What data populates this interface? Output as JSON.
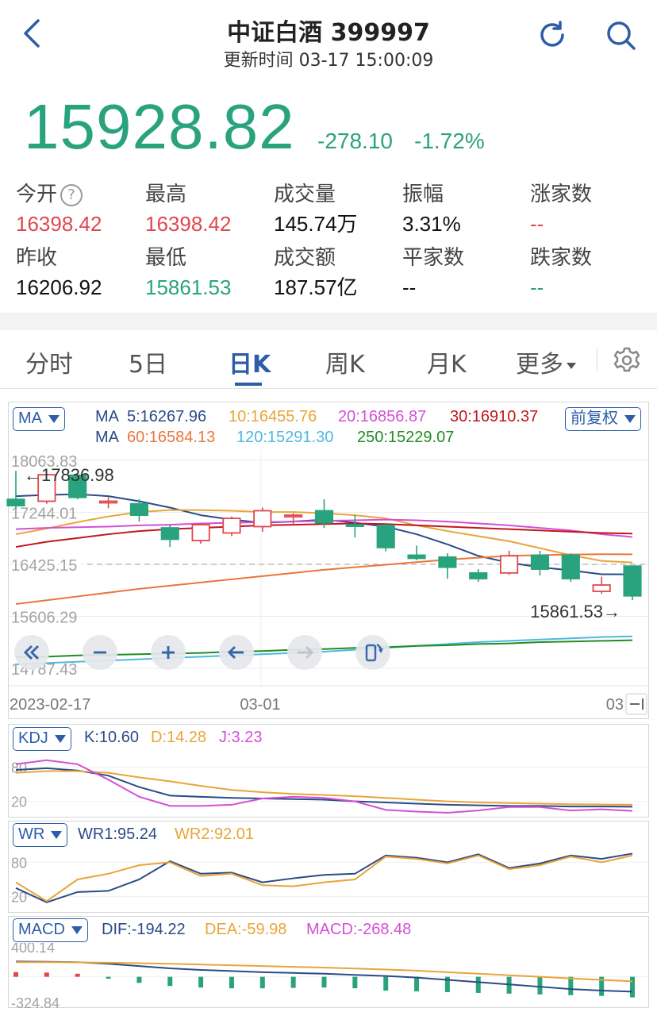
{
  "header": {
    "title": "中证白酒 399997",
    "update_label": "更新时间 03-17 15:00:09"
  },
  "quote": {
    "price": "15928.82",
    "change": "-278.10",
    "change_pct": "-1.72%"
  },
  "stats": [
    {
      "label": "今开",
      "value": "16398.42",
      "color": "red"
    },
    {
      "label": "最高",
      "value": "16398.42",
      "color": "red"
    },
    {
      "label": "成交量",
      "value": "145.74万",
      "color": "dark"
    },
    {
      "label": "振幅",
      "value": "3.31%",
      "color": "dark"
    },
    {
      "label": "涨家数",
      "value": "--",
      "color": "red"
    },
    {
      "label": "昨收",
      "value": "16206.92",
      "color": "dark"
    },
    {
      "label": "最低",
      "value": "15861.53",
      "color": "green"
    },
    {
      "label": "成交额",
      "value": "187.57亿",
      "color": "dark"
    },
    {
      "label": "平家数",
      "value": "--",
      "color": "dark"
    },
    {
      "label": "跌家数",
      "value": "--",
      "color": "green"
    }
  ],
  "tabs": [
    {
      "label": "分时"
    },
    {
      "label": "5日"
    },
    {
      "label": "日K"
    },
    {
      "label": "周K"
    },
    {
      "label": "月K"
    },
    {
      "label": "更多"
    }
  ],
  "main_panel": {
    "selector": "MA",
    "adjust": "前复权",
    "ma_label_row1": "MA",
    "ma_label_row2": "MA",
    "ma5": "5:16267.96",
    "ma10": "10:16455.76",
    "ma20": "20:16856.87",
    "ma30": "30:16910.37",
    "ma60": "60:16584.13",
    "ma120": "120:15291.30",
    "ma250": "250:15229.07",
    "high_mark": "←17836.98",
    "low_mark": "15861.53→",
    "current_price_line": "16425.15",
    "dates": [
      "2023-02-17",
      "03-01",
      "03"
    ]
  },
  "kdj": {
    "selector": "KDJ",
    "k": "K:10.60",
    "d": "D:14.28",
    "j": "J:3.23"
  },
  "wr": {
    "selector": "WR",
    "wr1": "WR1:95.24",
    "wr2": "WR2:92.01"
  },
  "macd": {
    "selector": "MACD",
    "dif": "DIF:-194.22",
    "dea": "DEA:-59.98",
    "macd": "MACD:-268.48"
  },
  "colors": {
    "up": "#e0474d",
    "down": "#29a37e",
    "accent": "#2d5da8"
  },
  "chart_data": [
    {
      "type": "candlestick",
      "title": "",
      "y_ticks": [
        "18063.83",
        "17244.01",
        "16425.15",
        "15606.29",
        "14787.43"
      ],
      "ylim": [
        14787.43,
        18063.83
      ],
      "x_labels": [
        "2023-02-17",
        "03-01",
        "03"
      ],
      "candles": [
        {
          "o": 17450,
          "h": 17900,
          "l": 17300,
          "c": 17350
        },
        {
          "o": 17420,
          "h": 17850,
          "l": 17380,
          "c": 17836.98
        },
        {
          "o": 17830,
          "h": 17850,
          "l": 17450,
          "c": 17480
        },
        {
          "o": 17400,
          "h": 17480,
          "l": 17310,
          "c": 17420
        },
        {
          "o": 17380,
          "h": 17450,
          "l": 17100,
          "c": 17200
        },
        {
          "o": 17000,
          "h": 17050,
          "l": 16700,
          "c": 16820
        },
        {
          "o": 16800,
          "h": 17080,
          "l": 16750,
          "c": 17050
        },
        {
          "o": 16920,
          "h": 17180,
          "l": 16870,
          "c": 17150
        },
        {
          "o": 17020,
          "h": 17320,
          "l": 16940,
          "c": 17270
        },
        {
          "o": 17180,
          "h": 17230,
          "l": 17050,
          "c": 17200
        },
        {
          "o": 17270,
          "h": 17450,
          "l": 17000,
          "c": 17080
        },
        {
          "o": 17050,
          "h": 17200,
          "l": 16850,
          "c": 17040
        },
        {
          "o": 17040,
          "h": 17060,
          "l": 16630,
          "c": 16690
        },
        {
          "o": 16570,
          "h": 16720,
          "l": 16490,
          "c": 16520
        },
        {
          "o": 16540,
          "h": 16600,
          "l": 16200,
          "c": 16380
        },
        {
          "o": 16290,
          "h": 16350,
          "l": 16150,
          "c": 16200
        },
        {
          "o": 16290,
          "h": 16640,
          "l": 16260,
          "c": 16560
        },
        {
          "o": 16570,
          "h": 16640,
          "l": 16250,
          "c": 16350
        },
        {
          "o": 16570,
          "h": 16600,
          "l": 16150,
          "c": 16200
        },
        {
          "o": 16000,
          "h": 16230,
          "l": 15960,
          "c": 16100
        },
        {
          "o": 16398.42,
          "h": 16398.42,
          "l": 15861.53,
          "c": 15928.82
        }
      ],
      "ma": {
        "ma5": [
          17500,
          17520,
          17530,
          17500,
          17420,
          17320,
          17200,
          17130,
          17080,
          17100,
          17130,
          17080,
          17020,
          16900,
          16740,
          16560,
          16450,
          16380,
          16330,
          16270,
          16267.96
        ],
        "ma10": [
          16900,
          16990,
          17090,
          17180,
          17250,
          17280,
          17280,
          17270,
          17250,
          17250,
          17230,
          17200,
          17150,
          17040,
          16950,
          16870,
          16790,
          16680,
          16570,
          16480,
          16455.76
        ],
        "ma20": [
          16980,
          17000,
          17010,
          17020,
          17040,
          17050,
          17070,
          17080,
          17090,
          17100,
          17110,
          17120,
          17130,
          17120,
          17100,
          17070,
          17040,
          17000,
          16960,
          16900,
          16856.87
        ],
        "ma30": [
          16700,
          16780,
          16840,
          16900,
          16950,
          16980,
          17000,
          17020,
          17040,
          17050,
          17060,
          17070,
          17060,
          17040,
          17020,
          17000,
          16980,
          16960,
          16940,
          16920,
          16910.37
        ],
        "ma60": [
          15800,
          15860,
          15920,
          15980,
          16040,
          16090,
          16140,
          16190,
          16240,
          16290,
          16340,
          16380,
          16420,
          16460,
          16500,
          16530,
          16560,
          16570,
          16580,
          16585,
          16584.13
        ],
        "ma120": [
          14850,
          14870,
          14890,
          14910,
          14930,
          14950,
          14970,
          14990,
          15010,
          15030,
          15050,
          15080,
          15110,
          15140,
          15170,
          15200,
          15220,
          15240,
          15260,
          15280,
          15291.3
        ],
        "ma250": [
          14960,
          14970,
          14990,
          15000,
          15010,
          15020,
          15030,
          15050,
          15060,
          15080,
          15090,
          15110,
          15120,
          15140,
          15150,
          15170,
          15180,
          15200,
          15210,
          15220,
          15229.07
        ]
      }
    },
    {
      "type": "line",
      "title": "KDJ",
      "y_ticks": [
        "80",
        "20"
      ],
      "ylim": [
        0,
        100
      ],
      "series": [
        {
          "name": "K",
          "values": [
            75,
            78,
            74,
            65,
            45,
            30,
            28,
            26,
            25,
            24,
            23,
            20,
            18,
            16,
            14,
            13,
            12,
            12,
            11,
            11,
            10.6
          ]
        },
        {
          "name": "D",
          "values": [
            70,
            73,
            73,
            70,
            62,
            55,
            47,
            40,
            36,
            33,
            31,
            29,
            26,
            23,
            20,
            18,
            17,
            16,
            15,
            14.5,
            14.28
          ]
        },
        {
          "name": "J",
          "values": [
            85,
            92,
            85,
            58,
            28,
            12,
            12,
            14,
            25,
            28,
            26,
            20,
            5,
            2,
            0,
            4,
            10,
            10,
            4,
            6,
            3.23
          ]
        }
      ]
    },
    {
      "type": "line",
      "title": "WR",
      "y_ticks": [
        "80",
        "20"
      ],
      "ylim": [
        0,
        100
      ],
      "series": [
        {
          "name": "WR1",
          "values": [
            35,
            10,
            28,
            30,
            50,
            82,
            60,
            62,
            45,
            52,
            58,
            60,
            92,
            88,
            80,
            94,
            70,
            78,
            92,
            86,
            95.24
          ]
        },
        {
          "name": "WR2",
          "values": [
            45,
            12,
            50,
            60,
            75,
            80,
            56,
            60,
            40,
            38,
            45,
            50,
            90,
            86,
            78,
            92,
            68,
            75,
            90,
            80,
            92.01
          ]
        }
      ]
    },
    {
      "type": "bar",
      "title": "MACD",
      "y_ticks": [
        "400.14",
        "-324.84"
      ],
      "ylim": [
        -324.84,
        400.14
      ],
      "values": [
        60,
        55,
        40,
        -25,
        -80,
        -120,
        -140,
        -150,
        -150,
        -145,
        -140,
        -150,
        -180,
        -190,
        -200,
        -210,
        -220,
        -230,
        -240,
        -250,
        -268.48
      ],
      "series": [
        {
          "name": "DIF",
          "values": [
            200,
            195,
            190,
            170,
            140,
            110,
            90,
            75,
            60,
            50,
            40,
            25,
            10,
            -10,
            -40,
            -70,
            -100,
            -130,
            -160,
            -180,
            -194.22
          ]
        },
        {
          "name": "DEA",
          "values": [
            190,
            190,
            188,
            184,
            178,
            170,
            160,
            150,
            140,
            130,
            120,
            108,
            95,
            80,
            60,
            40,
            20,
            0,
            -20,
            -40,
            -59.98
          ]
        }
      ]
    }
  ]
}
